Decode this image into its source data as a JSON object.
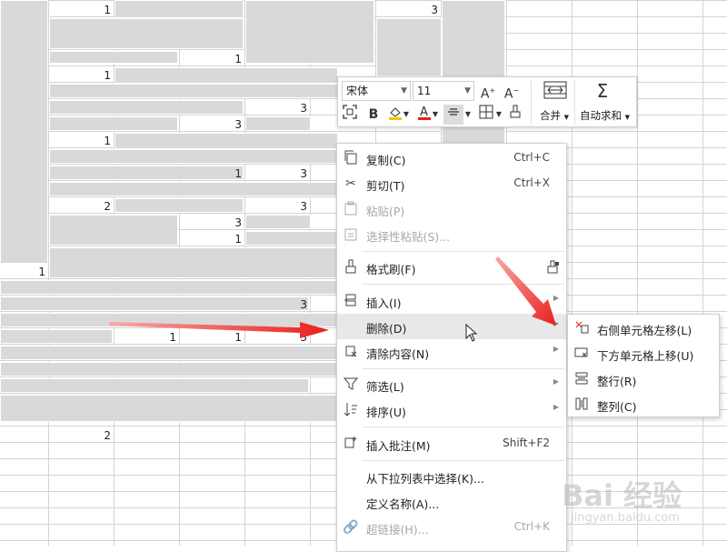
{
  "sheet": {
    "numbers": [
      "1",
      "3",
      "1",
      "1",
      "3",
      "3",
      "1",
      "1",
      "3",
      "2",
      "3",
      "3",
      "1",
      "1",
      "3",
      "1",
      "1",
      "1",
      "3",
      "2"
    ]
  },
  "mini_toolbar": {
    "font_name": "宋体",
    "font_size": "11",
    "merge_label": "合并",
    "autosum_label": "自动求和"
  },
  "context_menu": {
    "items": [
      {
        "label": "复制(C)",
        "shortcut": "Ctrl+C",
        "icon": "copy-icon"
      },
      {
        "label": "剪切(T)",
        "shortcut": "Ctrl+X",
        "icon": "scissors-icon"
      },
      {
        "label": "粘贴(P)",
        "shortcut": "",
        "icon": "paste-icon"
      },
      {
        "label": "选择性粘贴(S)...",
        "shortcut": "",
        "icon": "paste-special-icon"
      },
      {
        "label": "格式刷(F)",
        "shortcut": "",
        "icon": "format-brush-icon"
      },
      {
        "label": "插入(I)",
        "shortcut": "",
        "icon": "insert-icon"
      },
      {
        "label": "删除(D)",
        "shortcut": "",
        "icon": ""
      },
      {
        "label": "清除内容(N)",
        "shortcut": "",
        "icon": "eraser-icon"
      },
      {
        "label": "筛选(L)",
        "shortcut": "",
        "icon": "filter-icon"
      },
      {
        "label": "排序(U)",
        "shortcut": "",
        "icon": "sort-icon"
      },
      {
        "label": "插入批注(M)",
        "shortcut": "Shift+F2",
        "icon": "comment-icon"
      },
      {
        "label": "从下拉列表中选择(K)...",
        "shortcut": "",
        "icon": ""
      },
      {
        "label": "定义名称(A)...",
        "shortcut": "",
        "icon": ""
      },
      {
        "label": "超链接(H)...",
        "shortcut": "Ctrl+K",
        "icon": "link-icon"
      }
    ]
  },
  "submenu": {
    "items": [
      {
        "label": "右侧单元格左移(L)",
        "icon": "shift-left-icon"
      },
      {
        "label": "下方单元格上移(U)",
        "icon": "shift-up-icon"
      },
      {
        "label": "整行(R)",
        "icon": "entire-row-icon"
      },
      {
        "label": "整列(C)",
        "icon": "entire-column-icon"
      }
    ]
  },
  "watermark": {
    "brand": "Bai 经验",
    "url": "jingyan.baidu.com"
  },
  "colors": {
    "arrow_red": "#e8201c",
    "cell_fill": "#d9d9d9",
    "hover_bg": "#e8e8e8",
    "font_color_bar": "#e8201c",
    "highlight_bar": "#f5c400"
  }
}
